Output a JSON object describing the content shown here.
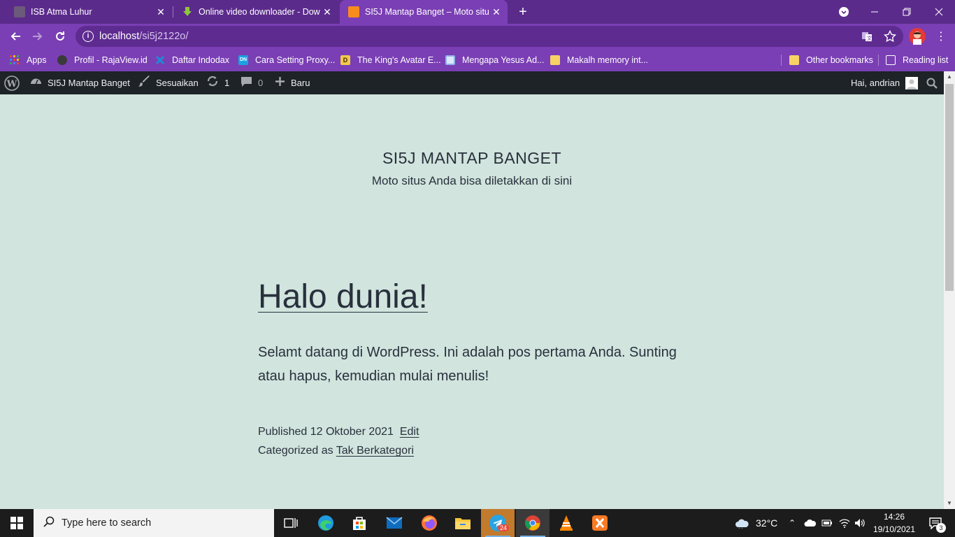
{
  "browser": {
    "tabs": [
      {
        "title": "ISB Atma Luhur",
        "favicon_color": "#6b5a7a"
      },
      {
        "title": "Online video downloader - Down",
        "favicon_color": "#8dc63f"
      },
      {
        "title": "SI5J Mantap Banget – Moto situs",
        "favicon_color": "#f98c1b"
      }
    ],
    "new_tab_label": "+",
    "address": {
      "host": "localhost",
      "path": "/si5j2122o/"
    },
    "bookmarks": [
      {
        "label": "Apps",
        "icon": "apps-grid-icon",
        "color": "#e7583c"
      },
      {
        "label": "Profil - RajaView.id",
        "icon": "gear-icon",
        "color": "#ffffff"
      },
      {
        "label": "Daftar Indodax",
        "icon": "indodax-icon",
        "color": "#1f8ad4"
      },
      {
        "label": "Cara Setting Proxy...",
        "icon": "dn-icon",
        "color": "#1ba1e2"
      },
      {
        "label": "The King's Avatar E...",
        "icon": "d-icon",
        "color": "#f2c94c"
      },
      {
        "label": "Mengapa Yesus Ad...",
        "icon": "page-icon",
        "color": "#8fb3e8"
      },
      {
        "label": "Makalh memory int...",
        "icon": "folder-icon",
        "color": "#f6d365"
      }
    ],
    "other_bookmarks": "Other bookmarks",
    "reading_list": "Reading list"
  },
  "adminbar": {
    "site_name": "SI5J Mantap Banget",
    "customize": "Sesuaikan",
    "updates_count": "1",
    "comments_count": "0",
    "new_label": "Baru",
    "greeting": "Hai, andrian"
  },
  "site": {
    "title": "SI5J MANTAP BANGET",
    "description": "Moto situs Anda bisa diletakkan di sini"
  },
  "post": {
    "title": "Halo dunia!",
    "body": "Selamt datang di WordPress. Ini adalah pos pertama Anda. Sunting atau hapus, kemudian mulai menulis!",
    "published_prefix": "Published",
    "published_date": "12 Oktober 2021",
    "edit_label": "Edit",
    "categorized_prefix": "Categorized as",
    "category": "Tak Berkategori"
  },
  "taskbar": {
    "search_placeholder": "Type here to search",
    "telegram_badge": "24",
    "weather": "32°C",
    "time": "14:26",
    "date": "19/10/2021",
    "notifications": "3"
  },
  "colors": {
    "chrome_frame": "#5b2b8c",
    "chrome_toolbar": "#7a3fb4",
    "wp_adminbar": "#1d2327",
    "page_bg": "#d1e4dd",
    "text": "#28303d"
  }
}
